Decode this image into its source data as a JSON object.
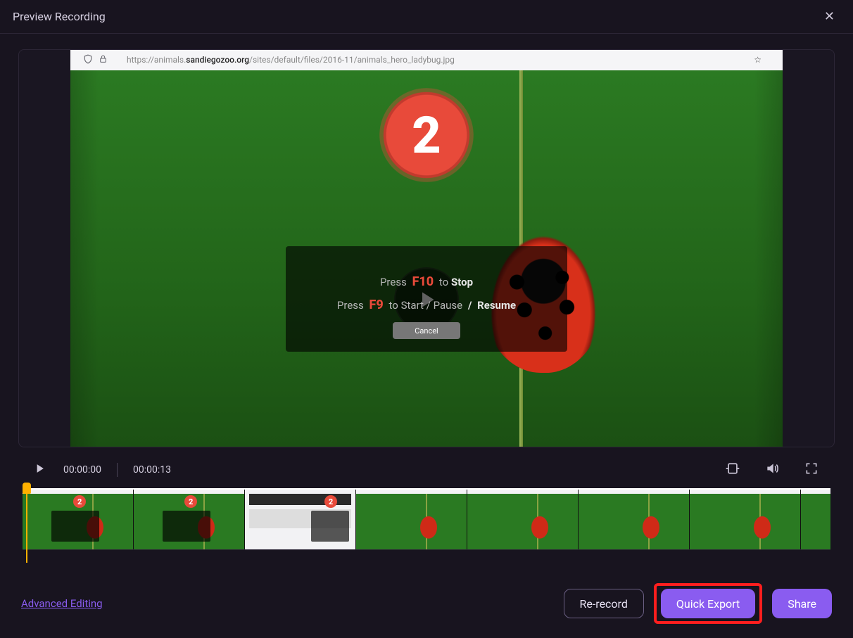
{
  "window": {
    "title": "Preview Recording"
  },
  "recorded_page": {
    "url_prefix": "https://animals.",
    "url_host": "sandiegozoo.org",
    "url_path": "/sites/default/files/2016-11/animals_hero_ladybug.jpg"
  },
  "countdown": {
    "value": "2"
  },
  "help_overlay": {
    "line1_pre": "Press",
    "line1_key": "F10",
    "line1_mid": "to",
    "line1_action": "Stop",
    "line2_pre": "Press",
    "line2_key": "F9",
    "line2_mid": "to",
    "line2_a": "Start",
    "line2_sep1": "/",
    "line2_b": "Pause",
    "line2_sep2": "/",
    "line2_c": "Resume",
    "cancel": "Cancel"
  },
  "transport": {
    "current_time": "00:00:00",
    "total_time": "00:00:13"
  },
  "timeline": {
    "thumb_badge": "2"
  },
  "footer": {
    "advanced": "Advanced Editing",
    "rerecord": "Re-record",
    "quick_export": "Quick Export",
    "share": "Share"
  }
}
